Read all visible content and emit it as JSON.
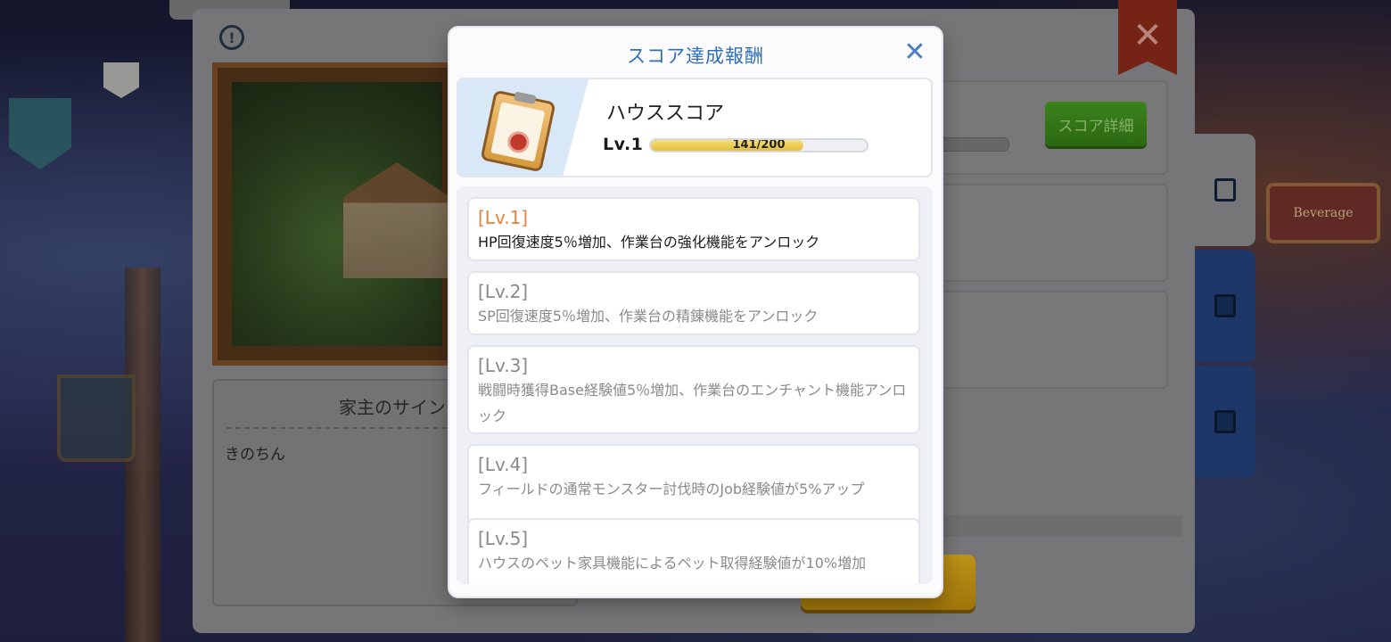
{
  "background": {
    "beverage_sign": "Beverage"
  },
  "panel": {
    "info_icon": "!",
    "sign_title": "家主のサイン",
    "sign_name": "きのちん",
    "score_detail_label": "スコア詳細",
    "close_glyph": "✕"
  },
  "modal": {
    "title": "スコア達成報酬",
    "close_glyph": "✕",
    "header": {
      "label": "ハウススコア",
      "level": "Lv.1",
      "progress_text": "141/200",
      "progress_value": 141,
      "progress_max": 200
    },
    "rewards": [
      {
        "level": "[Lv.1]",
        "desc": "HP回復速度5％増加、作業台の強化機能をアンロック",
        "active": true
      },
      {
        "level": "[Lv.2]",
        "desc": "SP回復速度5％増加、作業台の精錬機能をアンロック",
        "active": false
      },
      {
        "level": "[Lv.3]",
        "desc": "戦闘時獲得Base経験値5％増加、作業台のエンチャント機能アンロック",
        "active": false
      },
      {
        "level": "[Lv.4]",
        "desc": "フィールドの通常モンスター討伐時のJob経験値が5%アップ",
        "active": false
      },
      {
        "level": "[Lv.5]",
        "desc": "ハウスのペット家具機能によるペット取得経験値が10%増加",
        "active": false
      }
    ]
  },
  "colors": {
    "accent_blue": "#2f6fb8",
    "active_level_orange": "#e9803a",
    "progress_gold": "#e4bd3a",
    "score_button_green": "#3f8a1f"
  }
}
